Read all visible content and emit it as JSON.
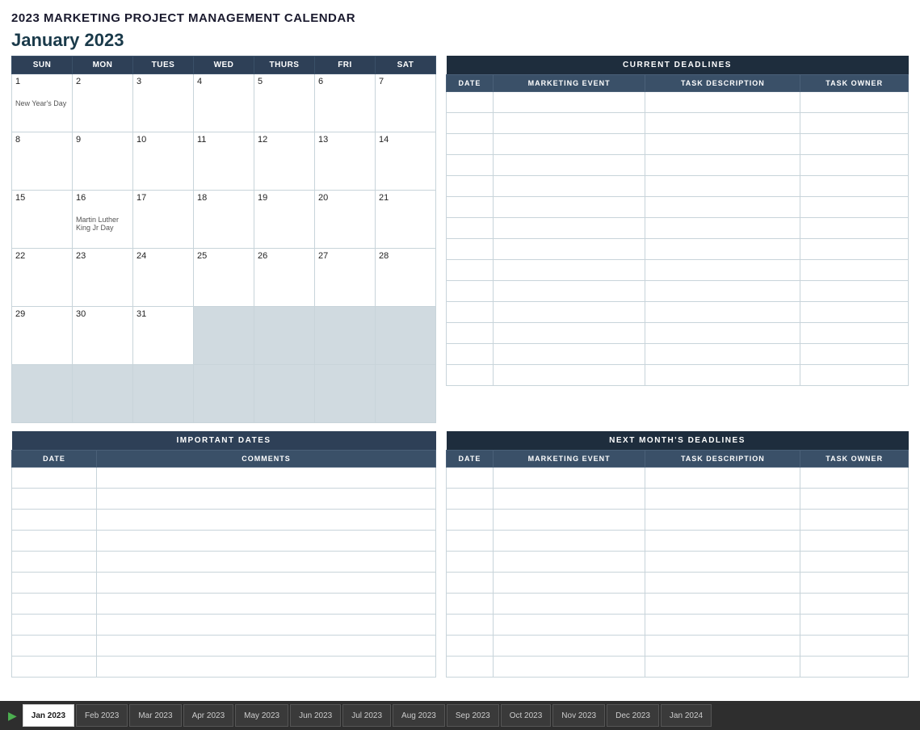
{
  "title": "2023 MARKETING PROJECT MANAGEMENT CALENDAR",
  "current_month": "January 2023",
  "calendar": {
    "headers": [
      "SUN",
      "MON",
      "TUES",
      "WED",
      "THURS",
      "FRI",
      "SAT"
    ],
    "weeks": [
      [
        {
          "num": "1",
          "holiday": "New Year's Day",
          "inactive": false
        },
        {
          "num": "2",
          "holiday": "",
          "inactive": false
        },
        {
          "num": "3",
          "holiday": "",
          "inactive": false
        },
        {
          "num": "4",
          "holiday": "",
          "inactive": false
        },
        {
          "num": "5",
          "holiday": "",
          "inactive": false
        },
        {
          "num": "6",
          "holiday": "",
          "inactive": false
        },
        {
          "num": "7",
          "holiday": "",
          "inactive": false
        }
      ],
      [
        {
          "num": "8",
          "holiday": "",
          "inactive": false
        },
        {
          "num": "9",
          "holiday": "",
          "inactive": false
        },
        {
          "num": "10",
          "holiday": "",
          "inactive": false
        },
        {
          "num": "11",
          "holiday": "",
          "inactive": false
        },
        {
          "num": "12",
          "holiday": "",
          "inactive": false
        },
        {
          "num": "13",
          "holiday": "",
          "inactive": false
        },
        {
          "num": "14",
          "holiday": "",
          "inactive": false
        }
      ],
      [
        {
          "num": "15",
          "holiday": "",
          "inactive": false
        },
        {
          "num": "16",
          "holiday": "Martin Luther King Jr Day",
          "inactive": false
        },
        {
          "num": "17",
          "holiday": "",
          "inactive": false
        },
        {
          "num": "18",
          "holiday": "",
          "inactive": false
        },
        {
          "num": "19",
          "holiday": "",
          "inactive": false
        },
        {
          "num": "20",
          "holiday": "",
          "inactive": false
        },
        {
          "num": "21",
          "holiday": "",
          "inactive": false
        }
      ],
      [
        {
          "num": "22",
          "holiday": "",
          "inactive": false
        },
        {
          "num": "23",
          "holiday": "",
          "inactive": false
        },
        {
          "num": "24",
          "holiday": "",
          "inactive": false
        },
        {
          "num": "25",
          "holiday": "",
          "inactive": false
        },
        {
          "num": "26",
          "holiday": "",
          "inactive": false
        },
        {
          "num": "27",
          "holiday": "",
          "inactive": false
        },
        {
          "num": "28",
          "holiday": "",
          "inactive": false
        }
      ],
      [
        {
          "num": "29",
          "holiday": "",
          "inactive": false
        },
        {
          "num": "30",
          "holiday": "",
          "inactive": false
        },
        {
          "num": "31",
          "holiday": "",
          "inactive": false
        },
        {
          "num": "",
          "holiday": "",
          "inactive": true
        },
        {
          "num": "",
          "holiday": "",
          "inactive": true
        },
        {
          "num": "",
          "holiday": "",
          "inactive": true
        },
        {
          "num": "",
          "holiday": "",
          "inactive": true
        }
      ],
      [
        {
          "num": "",
          "holiday": "",
          "inactive": true
        },
        {
          "num": "",
          "holiday": "",
          "inactive": true
        },
        {
          "num": "",
          "holiday": "",
          "inactive": true
        },
        {
          "num": "",
          "holiday": "",
          "inactive": true
        },
        {
          "num": "",
          "holiday": "",
          "inactive": true
        },
        {
          "num": "",
          "holiday": "",
          "inactive": true
        },
        {
          "num": "",
          "holiday": "",
          "inactive": true
        }
      ]
    ]
  },
  "current_deadlines": {
    "title": "CURRENT DEADLINES",
    "columns": [
      "DATE",
      "MARKETING EVENT",
      "TASK DESCRIPTION",
      "TASK OWNER"
    ],
    "rows": 14
  },
  "important_dates": {
    "title": "IMPORTANT DATES",
    "columns": [
      "DATE",
      "COMMENTS"
    ],
    "rows": 10
  },
  "next_deadlines": {
    "title": "NEXT MONTH'S DEADLINES",
    "columns": [
      "DATE",
      "MARKETING EVENT",
      "TASK DESCRIPTION",
      "TASK OWNER"
    ],
    "rows": 10
  },
  "tabs": [
    {
      "label": "Jan 2023",
      "active": true
    },
    {
      "label": "Feb 2023",
      "active": false
    },
    {
      "label": "Mar 2023",
      "active": false
    },
    {
      "label": "Apr 2023",
      "active": false
    },
    {
      "label": "May 2023",
      "active": false
    },
    {
      "label": "Jun 2023",
      "active": false
    },
    {
      "label": "Jul 2023",
      "active": false
    },
    {
      "label": "Aug 2023",
      "active": false
    },
    {
      "label": "Sep 2023",
      "active": false
    },
    {
      "label": "Oct 2023",
      "active": false
    },
    {
      "label": "Nov 2023",
      "active": false
    },
    {
      "label": "Dec 2023",
      "active": false
    },
    {
      "label": "Jan 2024",
      "active": false
    }
  ]
}
